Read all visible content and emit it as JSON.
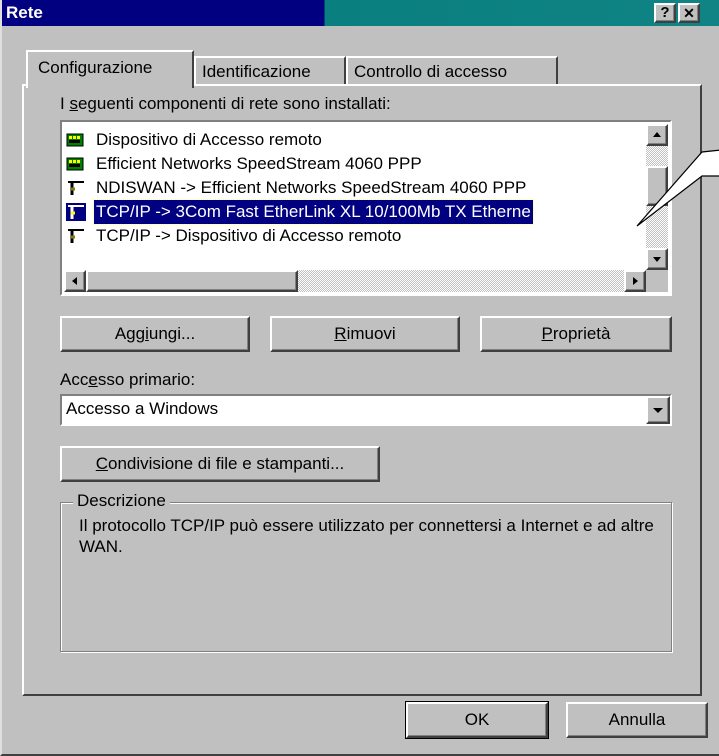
{
  "window": {
    "title": "Rete",
    "help_label": "?",
    "close_label": "✕"
  },
  "tabs": [
    {
      "label": "Configurazione",
      "active": true
    },
    {
      "label": "Identificazione",
      "active": false
    },
    {
      "label": "Controllo di accesso",
      "active": false
    }
  ],
  "components": {
    "label_prefix": "I ",
    "label_underlined": "s",
    "label_rest": "eguenti componenti di rete sono installati:",
    "items": [
      {
        "icon": "network-adapter-icon",
        "text": "Dispositivo di Accesso remoto",
        "selected": false
      },
      {
        "icon": "network-adapter-icon",
        "text": "Efficient Networks SpeedStream 4060 PPP",
        "selected": false
      },
      {
        "icon": "network-protocol-icon",
        "text": "NDISWAN -> Efficient Networks SpeedStream 4060 PPP",
        "selected": false
      },
      {
        "icon": "network-protocol-icon",
        "text": "TCP/IP -> 3Com Fast EtherLink XL 10/100Mb TX Etherne",
        "selected": true
      },
      {
        "icon": "network-protocol-icon",
        "text": "TCP/IP -> Dispositivo di Accesso remoto",
        "selected": false
      }
    ]
  },
  "buttons": {
    "add": {
      "pre": "Agg",
      "u": "i",
      "post": "ungi..."
    },
    "remove": {
      "pre": "",
      "u": "R",
      "post": "imuovi"
    },
    "properties": {
      "pre": "",
      "u": "P",
      "post": "roprietà"
    },
    "sharing": {
      "pre": "",
      "u": "C",
      "post": "ondivisione di file e stampanti..."
    },
    "ok": "OK",
    "cancel": "Annulla"
  },
  "primary_access": {
    "label_pre": "Acc",
    "label_u": "e",
    "label_post": "sso primario:",
    "value": "Accesso a Windows"
  },
  "description": {
    "legend": "Descrizione",
    "text": "Il protocollo TCP/IP può essere utilizzato per connettersi a Internet e ad altre WAN."
  },
  "colors": {
    "title_active": "#000080",
    "title_teal": "#108484",
    "selection": "#000080",
    "face": "#c0c0c0"
  }
}
